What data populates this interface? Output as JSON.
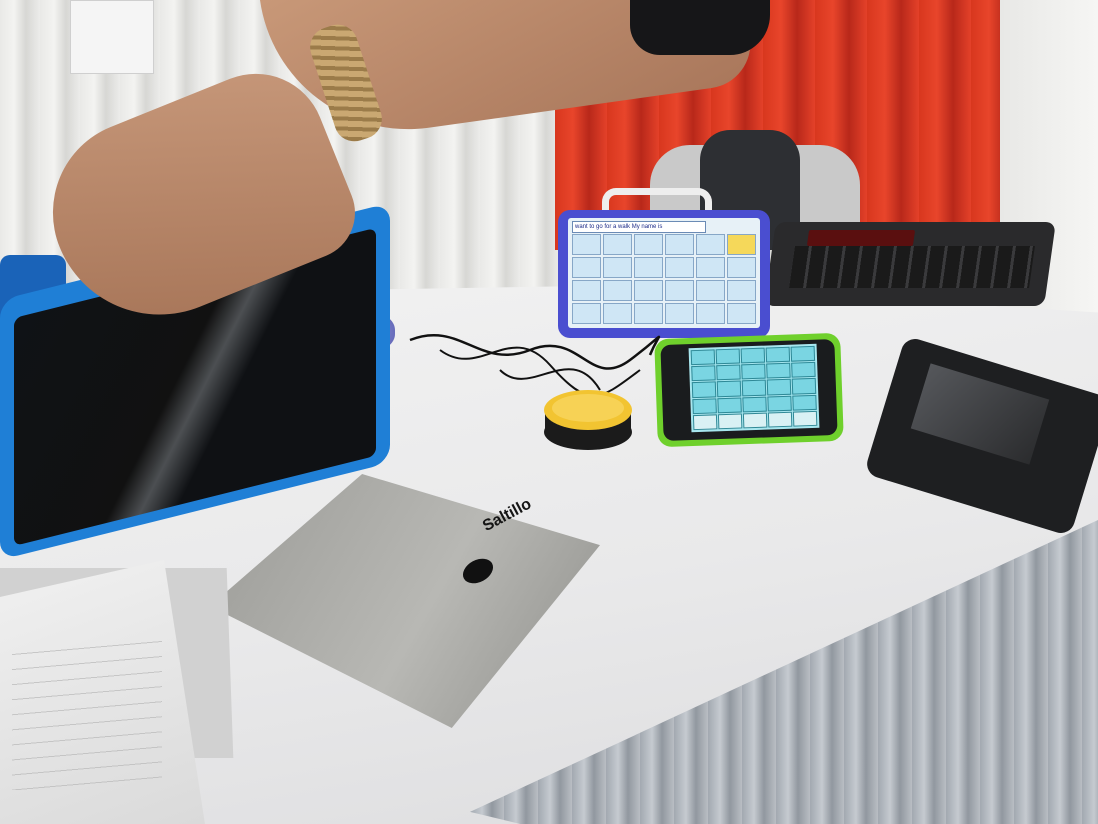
{
  "scene": {
    "cloth": {
      "brand": "Saltillo"
    },
    "center_tablet": {
      "title_text": "want to go for a walk My name is"
    },
    "colors": {
      "red_curtain": "#d8371e",
      "blue_case": "#1f7fd6",
      "tablet_case": "#4a4ed0",
      "phone_case": "#6fd02c",
      "switch_yellow": "#f2c431",
      "switch_blue": "#6b70c8"
    }
  }
}
